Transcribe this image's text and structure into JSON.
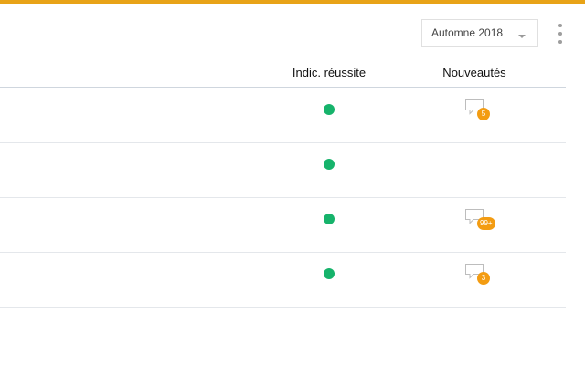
{
  "term_select": {
    "value": "Automne 2018"
  },
  "table": {
    "headers": {
      "success": "Indic. réussite",
      "news": "Nouveautés"
    },
    "rows": [
      {
        "badge": "5"
      },
      {
        "badge": null
      },
      {
        "badge": "99+"
      },
      {
        "badge": "3"
      }
    ]
  },
  "colors": {
    "accent": "#e8a317",
    "success": "#16b36b",
    "badge": "#f39c12"
  },
  "icons": {
    "news": "chat-bubble-icon",
    "menu": "more-vertical-icon",
    "select": "caret-down-icon"
  }
}
